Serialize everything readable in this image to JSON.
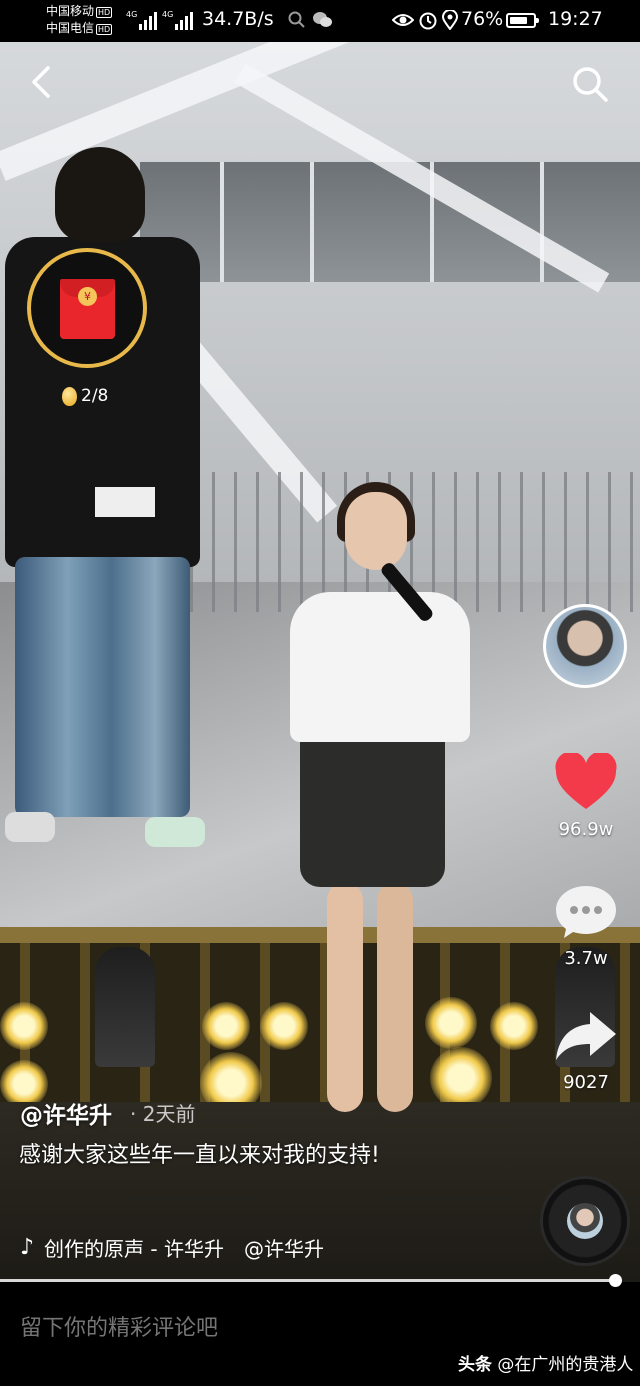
{
  "status_bar": {
    "carrier1": "中国移动",
    "carrier2": "中国电信",
    "hd_badge": "HD",
    "net_type": "4G",
    "net_speed": "34.7B/s",
    "battery": "76%",
    "battery_level": 0.76,
    "time": "19:27"
  },
  "icons": {
    "back": "back-arrow-icon",
    "search": "search-icon",
    "like": "heart-icon",
    "comment": "comment-bubble-icon",
    "share": "share-arrow-icon",
    "music": "tiktok-note-icon"
  },
  "colors": {
    "like": "#f23a4b",
    "red_packet": "#e8262b",
    "ring": "#e8b94a"
  },
  "red_packet": {
    "coin_symbol": "¥",
    "progress": "2/8"
  },
  "actions": {
    "likes": "96.9w",
    "comments": "3.7w",
    "shares": "9027"
  },
  "post": {
    "author": "@许华升",
    "time": "· 2天前",
    "caption": "感谢大家这些年一直以来对我的支持!",
    "music_text": "创作的原声 - 许华升　@许华升"
  },
  "playback": {
    "progress": 0.96
  },
  "comment_bar": {
    "placeholder": "留下你的精彩评论吧"
  },
  "watermark": {
    "brand": "头条",
    "handle": "@在广州的贵港人"
  }
}
